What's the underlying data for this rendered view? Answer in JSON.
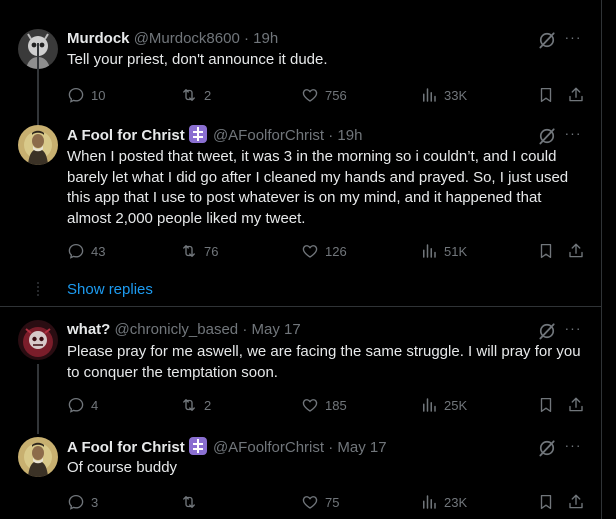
{
  "tweets": [
    {
      "name": "Murdock",
      "handle": "@Murdock8600",
      "time": "· 19h",
      "text": "Tell your priest, don't announce it dude.",
      "replies": "10",
      "reposts": "2",
      "likes": "756",
      "views": "33K",
      "more": "···"
    },
    {
      "name": "A Fool for Christ",
      "handle": "@AFoolforChrist",
      "time": "· 19h",
      "text": "When I posted that tweet, it was 3 in the morning so i couldn’t, and I could barely let what I did go after I cleaned my hands and prayed. So, I just used this app that I use to post whatever is on my mind, and it happened that almost 2,000 people liked my tweet.",
      "replies": "43",
      "reposts": "76",
      "likes": "126",
      "views": "51K",
      "more": "···"
    },
    {
      "name": "what?",
      "handle": "@chronicly_based",
      "time": "· May 17",
      "text": "Please pray for me aswell, we are facing the same struggle. I will pray for you to conquer the temptation soon.",
      "replies": "4",
      "reposts": "2",
      "likes": "185",
      "views": "25K",
      "more": "···"
    },
    {
      "name": "A Fool for Christ",
      "handle": "@AFoolforChrist",
      "time": "· May 17",
      "text": "Of course buddy",
      "replies": "3",
      "reposts": "",
      "likes": "75",
      "views": "23K",
      "more": "···"
    }
  ],
  "show_replies": "Show replies",
  "colors": {
    "accent": "#1d9bf0",
    "muted": "#71767b",
    "badge": "#8a6fd1"
  },
  "icons": [
    "reply-icon",
    "repost-icon",
    "like-icon",
    "views-icon",
    "bookmark-icon",
    "share-icon",
    "grok-icon",
    "more-icon",
    "orthodox-cross-icon"
  ]
}
